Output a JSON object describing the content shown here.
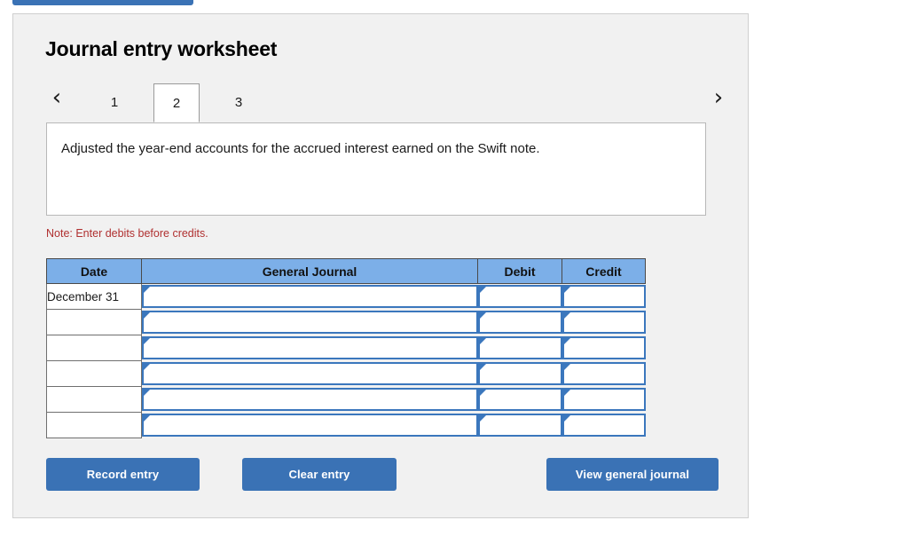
{
  "page": {
    "title": "Journal entry worksheet"
  },
  "top_button": {
    "label": ""
  },
  "tabs": {
    "prev_icon": "chevron-left",
    "next_icon": "chevron-right",
    "prev_glyph": "‹",
    "next_glyph": "›",
    "items": [
      {
        "label": "1",
        "active": false
      },
      {
        "label": "2",
        "active": true
      },
      {
        "label": "3",
        "active": false
      }
    ]
  },
  "description": {
    "text": "Adjusted the year-end accounts for the accrued interest earned on the Swift note."
  },
  "note": {
    "text": "Note: Enter debits before credits."
  },
  "journal": {
    "columns": [
      "Date",
      "General Journal",
      "Debit",
      "Credit"
    ],
    "rows": [
      {
        "date": "December 31",
        "general_journal": "",
        "debit": "",
        "credit": ""
      },
      {
        "date": "",
        "general_journal": "",
        "debit": "",
        "credit": ""
      },
      {
        "date": "",
        "general_journal": "",
        "debit": "",
        "credit": ""
      },
      {
        "date": "",
        "general_journal": "",
        "debit": "",
        "credit": ""
      },
      {
        "date": "",
        "general_journal": "",
        "debit": "",
        "credit": ""
      },
      {
        "date": "",
        "general_journal": "",
        "debit": "",
        "credit": ""
      }
    ]
  },
  "buttons": {
    "record": "Record entry",
    "clear": "Clear entry",
    "view": "View general journal"
  },
  "colors": {
    "panel_bg": "#f1f1f1",
    "button_blue": "#3a72b5",
    "table_header_blue": "#7cafe8",
    "note_red": "#b03030",
    "cell_border_blue": "#3b77bd"
  }
}
